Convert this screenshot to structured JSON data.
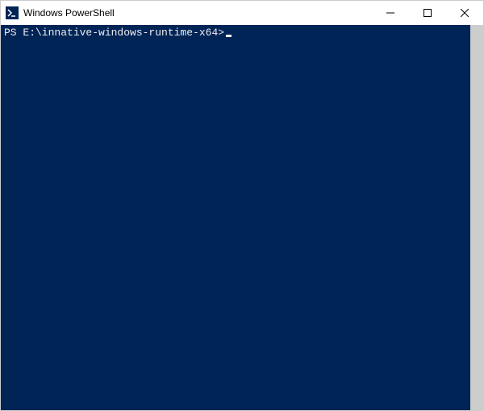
{
  "window": {
    "title": "Windows PowerShell"
  },
  "terminal": {
    "prompt": "PS E:\\innative-windows-runtime-x64>"
  },
  "colors": {
    "terminal_bg": "#012456",
    "terminal_fg": "#eeedf0"
  }
}
